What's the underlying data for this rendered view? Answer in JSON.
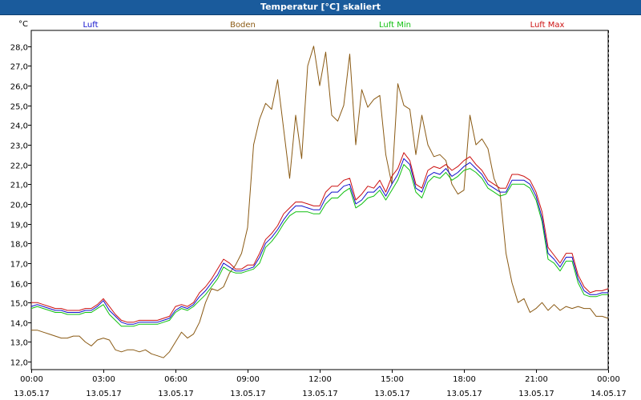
{
  "window": {
    "title": "Temperatur [°C] skaliert"
  },
  "chart_data": {
    "type": "line",
    "title": "Temperatur [°C] skaliert",
    "ylabel": "°C",
    "xlabel": "",
    "ylim": [
      11.6,
      28.8
    ],
    "yticks": [
      12.0,
      13.0,
      14.0,
      15.0,
      16.0,
      17.0,
      18.0,
      19.0,
      20.0,
      21.0,
      22.0,
      23.0,
      24.0,
      25.0,
      26.0,
      27.0,
      28.0
    ],
    "xlim": [
      0,
      24
    ],
    "xticks": [
      {
        "x": 0,
        "time": "00:00",
        "date": "13.05.17"
      },
      {
        "x": 3,
        "time": "03:00",
        "date": "13.05.17"
      },
      {
        "x": 6,
        "time": "06:00",
        "date": "13.05.17"
      },
      {
        "x": 9,
        "time": "09:00",
        "date": "13.05.17"
      },
      {
        "x": 12,
        "time": "12:00",
        "date": "13.05.17"
      },
      {
        "x": 15,
        "time": "15:00",
        "date": "13.05.17"
      },
      {
        "x": 18,
        "time": "18:00",
        "date": "13.05.17"
      },
      {
        "x": 21,
        "time": "21:00",
        "date": "13.05.17"
      },
      {
        "x": 24,
        "time": "00:00",
        "date": "14.05.17"
      }
    ],
    "grid": true,
    "legend_placement": "top",
    "colors": {
      "Luft": "#1010cc",
      "Boden": "#8a5a14",
      "Luft Min": "#10c010",
      "Luft Max": "#cc1010"
    },
    "x": [
      0,
      0.25,
      0.5,
      0.75,
      1,
      1.25,
      1.5,
      1.75,
      2,
      2.25,
      2.5,
      2.75,
      3,
      3.25,
      3.5,
      3.75,
      4,
      4.25,
      4.5,
      4.75,
      5,
      5.25,
      5.5,
      5.75,
      6,
      6.25,
      6.5,
      6.75,
      7,
      7.25,
      7.5,
      7.75,
      8,
      8.25,
      8.5,
      8.75,
      9,
      9.25,
      9.5,
      9.75,
      10,
      10.25,
      10.5,
      10.75,
      11,
      11.25,
      11.5,
      11.75,
      12,
      12.25,
      12.5,
      12.75,
      13,
      13.25,
      13.5,
      13.75,
      14,
      14.25,
      14.5,
      14.75,
      15,
      15.25,
      15.5,
      15.75,
      16,
      16.25,
      16.5,
      16.75,
      17,
      17.25,
      17.5,
      17.75,
      18,
      18.25,
      18.5,
      18.75,
      19,
      19.25,
      19.5,
      19.75,
      20,
      20.25,
      20.5,
      20.75,
      21,
      21.25,
      21.5,
      21.75,
      22,
      22.25,
      22.5,
      22.75,
      23,
      23.25,
      23.5,
      23.75,
      24
    ],
    "series": [
      {
        "name": "Luft",
        "values": [
          14.8,
          14.9,
          14.8,
          14.7,
          14.6,
          14.6,
          14.5,
          14.5,
          14.5,
          14.6,
          14.6,
          14.8,
          15.1,
          14.6,
          14.3,
          14.0,
          13.9,
          13.9,
          14.0,
          14.0,
          14.0,
          14.0,
          14.1,
          14.2,
          14.6,
          14.8,
          14.7,
          14.9,
          15.3,
          15.6,
          16.0,
          16.4,
          17.0,
          16.8,
          16.6,
          16.6,
          16.7,
          16.8,
          17.3,
          18.0,
          18.3,
          18.7,
          19.2,
          19.6,
          19.9,
          19.9,
          19.8,
          19.7,
          19.7,
          20.3,
          20.6,
          20.6,
          20.9,
          21.0,
          20.0,
          20.2,
          20.6,
          20.6,
          20.9,
          20.4,
          21.0,
          21.5,
          22.3,
          22.0,
          20.8,
          20.6,
          21.4,
          21.6,
          21.5,
          21.8,
          21.4,
          21.6,
          21.9,
          22.1,
          21.8,
          21.5,
          21.0,
          20.8,
          20.6,
          20.6,
          21.2,
          21.2,
          21.2,
          21.0,
          20.4,
          19.3,
          17.5,
          17.2,
          16.8,
          17.3,
          17.3,
          16.2,
          15.6,
          15.4,
          15.4,
          15.5,
          15.5,
          15.6,
          15.5,
          15.5,
          15.4,
          15.3,
          15.3,
          15.3
        ]
      },
      {
        "name": "Boden",
        "values": [
          13.6,
          13.6,
          13.5,
          13.4,
          13.3,
          13.2,
          13.2,
          13.3,
          13.3,
          13.0,
          12.8,
          13.1,
          13.2,
          13.1,
          12.6,
          12.5,
          12.6,
          12.6,
          12.5,
          12.6,
          12.4,
          12.3,
          12.2,
          12.5,
          13.0,
          13.5,
          13.2,
          13.4,
          14.0,
          15.0,
          15.7,
          15.6,
          15.8,
          16.5,
          16.9,
          17.5,
          18.8,
          23.0,
          24.3,
          25.1,
          24.8,
          26.3,
          23.8,
          21.3,
          24.5,
          22.3,
          27.0,
          28.0,
          26.0,
          27.7,
          24.5,
          24.2,
          25.0,
          27.6,
          23.0,
          25.8,
          24.9,
          25.3,
          25.5,
          22.5,
          21.0,
          26.1,
          25.0,
          24.8,
          22.5,
          24.5,
          23.0,
          22.4,
          22.5,
          22.2,
          21.0,
          20.5,
          20.7,
          24.5,
          23.0,
          23.3,
          22.8,
          21.3,
          20.6,
          17.5,
          16.0,
          15.0,
          15.2,
          14.5,
          14.7,
          15.0,
          14.6,
          14.9,
          14.6,
          14.8,
          14.7,
          14.8,
          14.7,
          14.7,
          14.3,
          14.3,
          14.2,
          14.2,
          14.1,
          14.0,
          13.9,
          13.9,
          13.9,
          13.9
        ]
      },
      {
        "name": "Luft Min",
        "values": [
          14.7,
          14.8,
          14.7,
          14.6,
          14.5,
          14.5,
          14.4,
          14.4,
          14.4,
          14.5,
          14.5,
          14.7,
          14.9,
          14.4,
          14.1,
          13.8,
          13.8,
          13.8,
          13.9,
          13.9,
          13.9,
          13.9,
          14.0,
          14.1,
          14.5,
          14.7,
          14.6,
          14.8,
          15.1,
          15.4,
          15.8,
          16.2,
          16.8,
          16.6,
          16.5,
          16.5,
          16.6,
          16.7,
          17.0,
          17.8,
          18.1,
          18.5,
          19.0,
          19.4,
          19.6,
          19.6,
          19.6,
          19.5,
          19.5,
          20.0,
          20.3,
          20.3,
          20.6,
          20.8,
          19.8,
          20.0,
          20.3,
          20.4,
          20.7,
          20.2,
          20.7,
          21.2,
          22.0,
          21.7,
          20.6,
          20.3,
          21.1,
          21.4,
          21.3,
          21.6,
          21.2,
          21.4,
          21.7,
          21.8,
          21.6,
          21.3,
          20.8,
          20.6,
          20.4,
          20.5,
          21.0,
          21.0,
          21.0,
          20.8,
          20.2,
          19.1,
          17.2,
          17.0,
          16.6,
          17.1,
          17.1,
          16.0,
          15.4,
          15.3,
          15.3,
          15.4,
          15.4,
          15.5,
          15.4,
          15.4,
          15.3,
          15.2,
          15.2,
          15.2
        ]
      },
      {
        "name": "Luft Max",
        "values": [
          15.0,
          15.0,
          14.9,
          14.8,
          14.7,
          14.7,
          14.6,
          14.6,
          14.6,
          14.7,
          14.7,
          14.9,
          15.2,
          14.8,
          14.4,
          14.1,
          14.0,
          14.0,
          14.1,
          14.1,
          14.1,
          14.1,
          14.2,
          14.3,
          14.8,
          14.9,
          14.8,
          15.0,
          15.5,
          15.8,
          16.2,
          16.7,
          17.2,
          17.0,
          16.7,
          16.7,
          16.9,
          16.9,
          17.5,
          18.2,
          18.5,
          18.9,
          19.5,
          19.8,
          20.1,
          20.1,
          20.0,
          19.9,
          19.9,
          20.6,
          20.9,
          20.9,
          21.2,
          21.3,
          20.2,
          20.5,
          20.9,
          20.8,
          21.2,
          20.6,
          21.4,
          21.8,
          22.6,
          22.2,
          21.0,
          20.8,
          21.7,
          21.9,
          21.8,
          22.0,
          21.7,
          21.9,
          22.2,
          22.4,
          22.0,
          21.7,
          21.2,
          21.0,
          20.8,
          20.8,
          21.5,
          21.5,
          21.4,
          21.2,
          20.6,
          19.6,
          17.8,
          17.4,
          17.0,
          17.5,
          17.5,
          16.4,
          15.8,
          15.5,
          15.6,
          15.6,
          15.7,
          15.7,
          15.6,
          15.6,
          15.5,
          15.4,
          15.4,
          15.4
        ]
      }
    ]
  }
}
